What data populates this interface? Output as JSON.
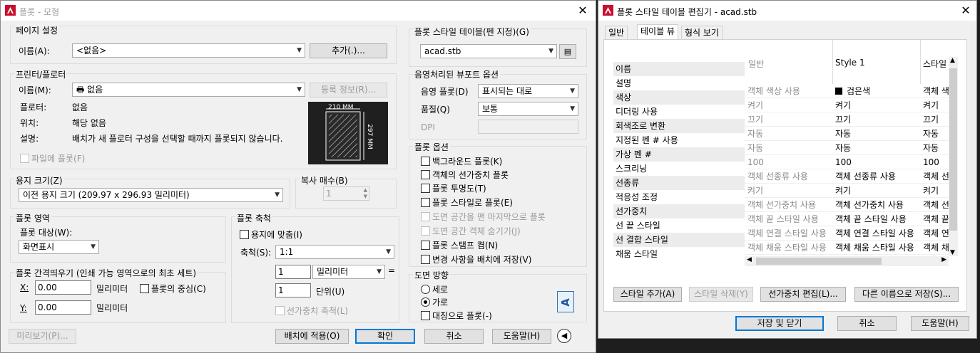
{
  "plot_dialog": {
    "title": "플롯 - 모형",
    "page_setup": {
      "group": "페이지 설정",
      "name_label": "이름(A):",
      "name_value": "<없음>",
      "add_button": "추가(.)..."
    },
    "printer": {
      "group": "프린터/플로터",
      "name_label": "이름(M):",
      "name_value": "없음",
      "properties_button": "등록 정보(R)...",
      "plotter_label": "플로터:",
      "plotter_value": "없음",
      "where_label": "위치:",
      "where_value": "해당 없음",
      "desc_label": "설명:",
      "desc_value": "배치가 새 플로터 구성을 선택할 때까지 플롯되지 않습니다.",
      "plot_to_file": "파일에 플롯(F)",
      "preview_width": "210 MM",
      "preview_height": "297 MM"
    },
    "paper": {
      "group": "용지 크기(Z)",
      "value": "이전 용지 크기 (209.97 x 296.93 밀리미터)"
    },
    "copies": {
      "group": "복사 매수(B)",
      "value": "1"
    },
    "plot_area": {
      "group": "플롯 영역",
      "what_label": "플롯 대상(W):",
      "what_value": "화면표시"
    },
    "plot_offset": {
      "group": "플롯 간격띄우기 (인쇄 가능 영역으로의 최초 세트)",
      "x_label": "X:",
      "x_value": "0.00",
      "x_unit": "밀리미터",
      "center": "플롯의 중심(C)",
      "y_label": "Y:",
      "y_value": "0.00",
      "y_unit": "밀리미터"
    },
    "plot_scale": {
      "group": "플롯 축척",
      "fit": "용지에 맞춤(I)",
      "scale_label": "축척(S):",
      "scale_value": "1:1",
      "val1": "1",
      "unit1": "밀리미터",
      "eq": "=",
      "val2": "1",
      "unit2": "단위(U)",
      "lineweights": "선가중치 축척(L)"
    },
    "style_table": {
      "group": "플롯 스타일 테이블(펜 지정)(G)",
      "value": "acad.stb"
    },
    "shaded": {
      "group": "음영처리된 뷰포트 옵션",
      "shade_label": "음영 플롯(D)",
      "shade_value": "표시되는 대로",
      "quality_label": "품질(Q)",
      "quality_value": "보통",
      "dpi_label": "DPI"
    },
    "options": {
      "group": "플롯 옵션",
      "items": [
        {
          "label": "백그라운드 플롯(K)",
          "enabled": true
        },
        {
          "label": "객체의 선가중치 플롯",
          "enabled": true
        },
        {
          "label": "플롯 투명도(T)",
          "enabled": true
        },
        {
          "label": "플롯 스타일로 플롯(E)",
          "enabled": true
        },
        {
          "label": "도면 공간을 맨 마지막으로 플롯",
          "enabled": false
        },
        {
          "label": "도면 공간 객체 숨기기(J)",
          "enabled": false
        },
        {
          "label": "플롯 스탬프 켬(N)",
          "enabled": true
        },
        {
          "label": "변경 사항을 배치에 저장(V)",
          "enabled": true
        }
      ]
    },
    "orientation": {
      "group": "도면 방향",
      "portrait": "세로",
      "landscape": "가로",
      "upside_down": "대칭으로 플롯(-)",
      "icon_letter": "A"
    },
    "footer": {
      "preview": "미리보기(P)...",
      "apply": "배치에 적용(O)",
      "ok": "확인",
      "cancel": "취소",
      "help": "도움말(H)"
    }
  },
  "style_editor": {
    "title": "플롯 스타일 테이블 편집기 - acad.stb",
    "tabs": [
      "일반",
      "테이블 뷰",
      "형식 보기"
    ],
    "row_labels": [
      "이름",
      "설명",
      "색상",
      "디더링 사용",
      "회색조로 변환",
      "지정된 펜 # 사용",
      "가상 펜 #",
      "스크리닝",
      "선종류",
      "적응성 조정",
      "선가중치",
      "선 끝 스타일",
      "선 결합 스타일",
      "채움 스타일"
    ],
    "columns": [
      "일반",
      "Style 1",
      "스타일"
    ],
    "rows": [
      [
        "일반",
        "Style 1",
        "스타일"
      ],
      [
        "",
        "",
        ""
      ],
      [
        "객체 색상 사용",
        "검은색",
        "객체 색"
      ],
      [
        "켜기",
        "켜기",
        "켜기"
      ],
      [
        "끄기",
        "끄기",
        "끄기"
      ],
      [
        "자동",
        "자동",
        "자동"
      ],
      [
        "자동",
        "자동",
        "자동"
      ],
      [
        "100",
        "100",
        "100"
      ],
      [
        "객체 선종류 사용",
        "객체 선종류 사용",
        "객체 선"
      ],
      [
        "켜기",
        "켜기",
        "켜기"
      ],
      [
        "객체 선가중치 사용",
        "객체 선가중치 사용",
        "객체 선"
      ],
      [
        "객체 끝 스타일 사용",
        "객체 끝 스타일 사용",
        "객체 끝"
      ],
      [
        "객체 연결 스타일 사용",
        "객체 연결 스타일 사용",
        "객체 연"
      ],
      [
        "객체 채움 스타일 사용",
        "객체 채움 스타일 사용",
        "객체 채"
      ]
    ],
    "buttons": {
      "add_style": "스타일 추가(A)",
      "delete_style": "스타일 삭제(Y)",
      "edit_lineweights": "선가중치 편집(L)...",
      "save_as": "다른 이름으로 저장(S)..."
    },
    "footer": {
      "save_close": "저장 및 닫기",
      "cancel": "취소",
      "help": "도움말(H)"
    }
  }
}
